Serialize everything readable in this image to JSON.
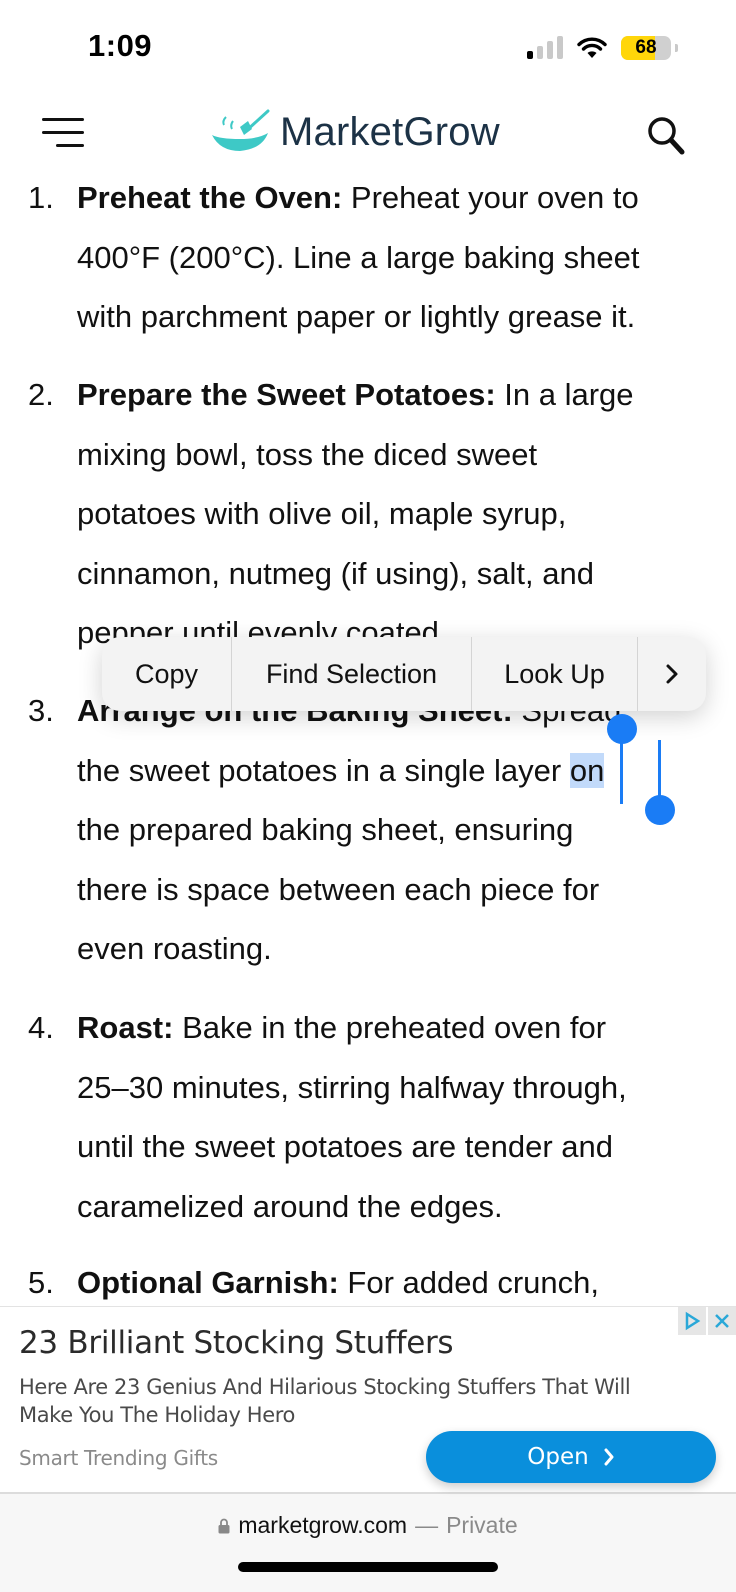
{
  "status_bar": {
    "time": "1:09",
    "battery_level": "68",
    "signal_bars_active": 1,
    "signal_bars_total": 4
  },
  "header": {
    "logo_text": "MarketGrow",
    "menu_icon": "hamburger-menu-icon",
    "search_icon": "search-icon",
    "brand_color": "#3ec9c6"
  },
  "article": {
    "steps": [
      {
        "number": "1.",
        "lines": [
          {
            "bold": "Preheat the Oven:",
            "text": " Preheat your oven to"
          },
          {
            "bold": "",
            "text": "400°F (200°C). Line a large baking sheet"
          },
          {
            "bold": "",
            "text": "with parchment paper or lightly grease it."
          }
        ]
      },
      {
        "number": "2.",
        "lines": [
          {
            "bold": "Prepare the Sweet Potatoes:",
            "text": " In a large"
          },
          {
            "bold": "",
            "text": "mixing bowl, toss the diced sweet"
          },
          {
            "bold": "",
            "text": "potatoes with olive oil, maple syrup,"
          },
          {
            "bold": "",
            "text": "cinnamon, nutmeg (if using), salt, and"
          },
          {
            "bold": "",
            "text": "pepper until evenly coated."
          }
        ]
      },
      {
        "number": "3.",
        "lines": [
          {
            "bold": "Arrange on the Baking Sheet:",
            "text": " Spread"
          },
          {
            "bold": "",
            "text": "the sweet potatoes in a single layer ",
            "selected": "on"
          },
          {
            "bold": "",
            "text": "the prepared baking sheet, ensuring"
          },
          {
            "bold": "",
            "text": "there is space between each piece for"
          },
          {
            "bold": "",
            "text": "even roasting."
          }
        ]
      },
      {
        "number": "4.",
        "lines": [
          {
            "bold": "Roast:",
            "text": " Bake in the preheated oven for"
          },
          {
            "bold": "",
            "text": "25–30 minutes, stirring halfway through,"
          },
          {
            "bold": "",
            "text": "until the sweet potatoes are tender and"
          },
          {
            "bold": "",
            "text": "caramelized around the edges."
          }
        ]
      },
      {
        "number": "5.",
        "lines": [
          {
            "bold": "Optional Garnish:",
            "text": " For added crunch,"
          }
        ]
      }
    ],
    "selected_text": "on"
  },
  "context_menu": {
    "items": [
      "Copy",
      "Find Selection",
      "Look Up"
    ],
    "more_icon": "chevron-right-icon"
  },
  "ad": {
    "title": "23 Brilliant Stocking Stuffers",
    "description": "Here Are 23 Genius And Hilarious Stocking Stuffers That Will Make You The Holiday Hero",
    "source": "Smart Trending Gifts",
    "cta_label": "Open",
    "cta_color": "#0a8fdc"
  },
  "url_bar": {
    "domain": "marketgrow.com",
    "separator": "—",
    "mode": "Private"
  }
}
